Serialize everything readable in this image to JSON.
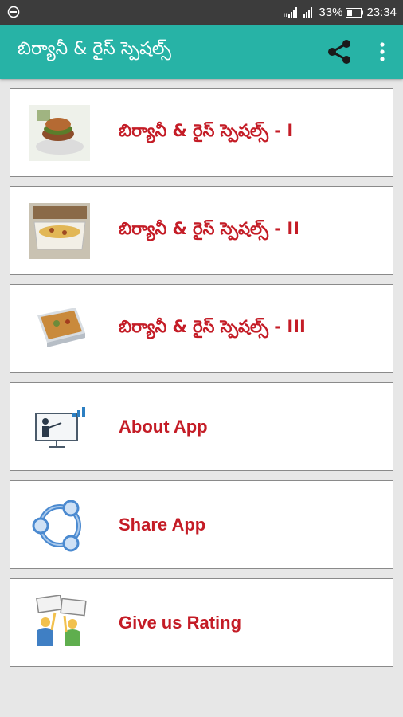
{
  "status_bar": {
    "battery_percent": "33%",
    "time": "23:34"
  },
  "toolbar": {
    "title": "బిర్యానీ & రైస్ స్పెషల్స్",
    "share_icon": "share-icon",
    "more_icon": "more-vert-icon"
  },
  "menu": {
    "items": [
      {
        "label": "బిర్యానీ & రైస్ స్పెషల్స్  - I",
        "icon": "burger-food-thumbnail"
      },
      {
        "label": "బిర్యానీ & రైస్ స్పెషల్స్  - II",
        "icon": "rice-dish-thumbnail"
      },
      {
        "label": "బిర్యానీ & రైస్ స్పెషల్స్  - III",
        "icon": "biryani-tray-thumbnail"
      },
      {
        "label": "About App",
        "icon": "presentation-icon"
      },
      {
        "label": "Share App",
        "icon": "share-circle-icon"
      },
      {
        "label": "Give us Rating",
        "icon": "rating-people-icon"
      }
    ]
  },
  "colors": {
    "toolbar": "#27b3a6",
    "status_bar": "#3c3c3c",
    "label_red": "#c41c26",
    "background": "#e7e7e7"
  }
}
